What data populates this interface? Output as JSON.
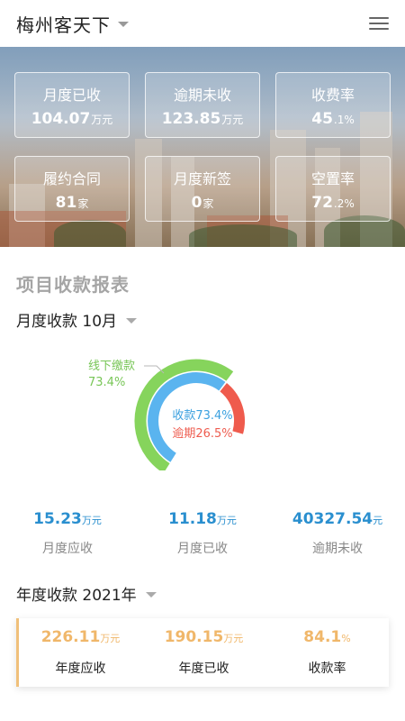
{
  "header": {
    "title": "梅州客天下"
  },
  "cards": [
    {
      "label": "月度已收",
      "value": "104.07",
      "unit": "万元"
    },
    {
      "label": "逾期未收",
      "value": "123.85",
      "unit": "万元"
    },
    {
      "label": "收费率",
      "value": "45",
      "unit": ".1%"
    },
    {
      "label": "履约合同",
      "value": "81",
      "unit": "家"
    },
    {
      "label": "月度新签",
      "value": "0",
      "unit": "家"
    },
    {
      "label": "空置率",
      "value": "72",
      "unit": ".2%"
    }
  ],
  "section": {
    "title": "项目收款报表"
  },
  "monthly": {
    "heading": "月度收款 10月",
    "donut": {
      "offline_label": "线下缴款",
      "offline_pct": "73.4%",
      "collected_text": "收款73.4%",
      "overdue_text": "逾期26.5%",
      "collected": 73.4,
      "overdue": 26.5,
      "offline": 73.4
    },
    "stats": [
      {
        "value": "15.23",
        "unit": "万元",
        "label": "月度应收"
      },
      {
        "value": "11.18",
        "unit": "万元",
        "label": "月度已收"
      },
      {
        "value": "40327.54",
        "unit": "元",
        "label": "逾期未收"
      }
    ]
  },
  "yearly": {
    "heading": "年度收款 2021年",
    "stats": [
      {
        "value": "226.11",
        "unit": "万元",
        "label": "年度应收"
      },
      {
        "value": "190.15",
        "unit": "万元",
        "label": "年度已收"
      },
      {
        "value": "84.1",
        "unit": "%",
        "label": "收款率"
      }
    ]
  },
  "colors": {
    "collected": "#5ab4ef",
    "overdue": "#ef5b4d",
    "offline": "#86d45c",
    "accent_year": "#f0b76a",
    "accent_month": "#2a8fcf"
  }
}
